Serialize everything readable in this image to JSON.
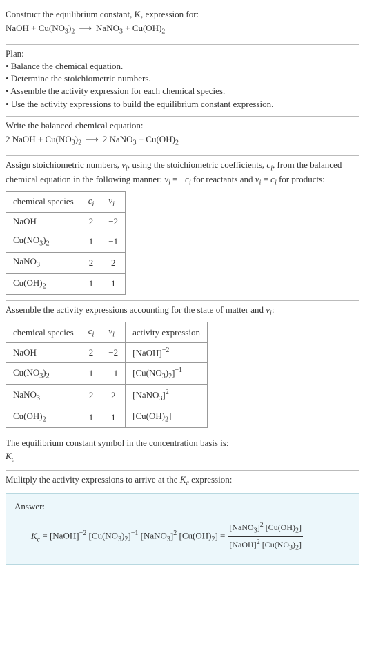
{
  "title_line1": "Construct the equilibrium constant, K, expression for:",
  "title_eq_html": "NaOH + Cu(NO<sub>3</sub>)<sub>2</sub><span class='arrow'>⟶</span>NaNO<sub>3</sub> + Cu(OH)<sub>2</sub>",
  "plan_header": "Plan:",
  "plan_items": [
    "• Balance the chemical equation.",
    "• Determine the stoichiometric numbers.",
    "• Assemble the activity expression for each chemical species.",
    "• Use the activity expressions to build the equilibrium constant expression."
  ],
  "balanced_header": "Write the balanced chemical equation:",
  "balanced_eq_html": "2 NaOH + Cu(NO<sub>3</sub>)<sub>2</sub><span class='arrow'>⟶</span>2 NaNO<sub>3</sub> + Cu(OH)<sub>2</sub>",
  "assign_text_html": "Assign stoichiometric numbers, <span class='ital'>ν<sub>i</sub></span>, using the stoichiometric coefficients, <span class='ital'>c<sub>i</sub></span>, from the balanced chemical equation in the following manner: <span class='ital'>ν<sub>i</sub></span> = −<span class='ital'>c<sub>i</sub></span> for reactants and <span class='ital'>ν<sub>i</sub></span> = <span class='ital'>c<sub>i</sub></span> for products:",
  "table1": {
    "headers_html": [
      "chemical species",
      "<span class='ital'>c<sub>i</sub></span>",
      "<span class='ital'>ν<sub>i</sub></span>"
    ],
    "rows_html": [
      [
        "NaOH",
        "2",
        "−2"
      ],
      [
        "Cu(NO<sub>3</sub>)<sub>2</sub>",
        "1",
        "−1"
      ],
      [
        "NaNO<sub>3</sub>",
        "2",
        "2"
      ],
      [
        "Cu(OH)<sub>2</sub>",
        "1",
        "1"
      ]
    ]
  },
  "assemble_text_html": "Assemble the activity expressions accounting for the state of matter and <span class='ital'>ν<sub>i</sub></span>:",
  "table2": {
    "headers_html": [
      "chemical species",
      "<span class='ital'>c<sub>i</sub></span>",
      "<span class='ital'>ν<sub>i</sub></span>",
      "activity expression"
    ],
    "rows_html": [
      [
        "NaOH",
        "2",
        "−2",
        "[NaOH]<sup>−2</sup>"
      ],
      [
        "Cu(NO<sub>3</sub>)<sub>2</sub>",
        "1",
        "−1",
        "[Cu(NO<sub>3</sub>)<sub>2</sub>]<sup>−1</sup>"
      ],
      [
        "NaNO<sub>3</sub>",
        "2",
        "2",
        "[NaNO<sub>3</sub>]<sup>2</sup>"
      ],
      [
        "Cu(OH)<sub>2</sub>",
        "1",
        "1",
        "[Cu(OH)<sub>2</sub>]"
      ]
    ]
  },
  "eq_symbol_text": "The equilibrium constant symbol in the concentration basis is:",
  "eq_symbol_html": "<span class='ital'>K<sub>c</sub></span>",
  "multiply_text_html": "Mulitply the activity expressions to arrive at the <span class='ital'>K<sub>c</sub></span> expression:",
  "answer_label": "Answer:",
  "answer_prefix_html": "<span class='ital'>K<sub>c</sub></span> = [NaOH]<sup>−2</sup> [Cu(NO<sub>3</sub>)<sub>2</sub>]<sup>−1</sup> [NaNO<sub>3</sub>]<sup>2</sup> [Cu(OH)<sub>2</sub>] =",
  "answer_frac_num_html": "[NaNO<sub>3</sub>]<sup>2</sup> [Cu(OH)<sub>2</sub>]",
  "answer_frac_den_html": "[NaOH]<sup>2</sup> [Cu(NO<sub>3</sub>)<sub>2</sub>]",
  "chart_data": {
    "type": "table",
    "stoichiometry": [
      {
        "species": "NaOH",
        "c_i": 2,
        "nu_i": -2,
        "activity": "[NaOH]^-2"
      },
      {
        "species": "Cu(NO3)2",
        "c_i": 1,
        "nu_i": -1,
        "activity": "[Cu(NO3)2]^-1"
      },
      {
        "species": "NaNO3",
        "c_i": 2,
        "nu_i": 2,
        "activity": "[NaNO3]^2"
      },
      {
        "species": "Cu(OH)2",
        "c_i": 1,
        "nu_i": 1,
        "activity": "[Cu(OH)2]"
      }
    ],
    "unbalanced_equation": "NaOH + Cu(NO3)2 -> NaNO3 + Cu(OH)2",
    "balanced_equation": "2 NaOH + Cu(NO3)2 -> 2 NaNO3 + Cu(OH)2",
    "Kc": "([NaNO3]^2 [Cu(OH)2]) / ([NaOH]^2 [Cu(NO3)2])"
  }
}
